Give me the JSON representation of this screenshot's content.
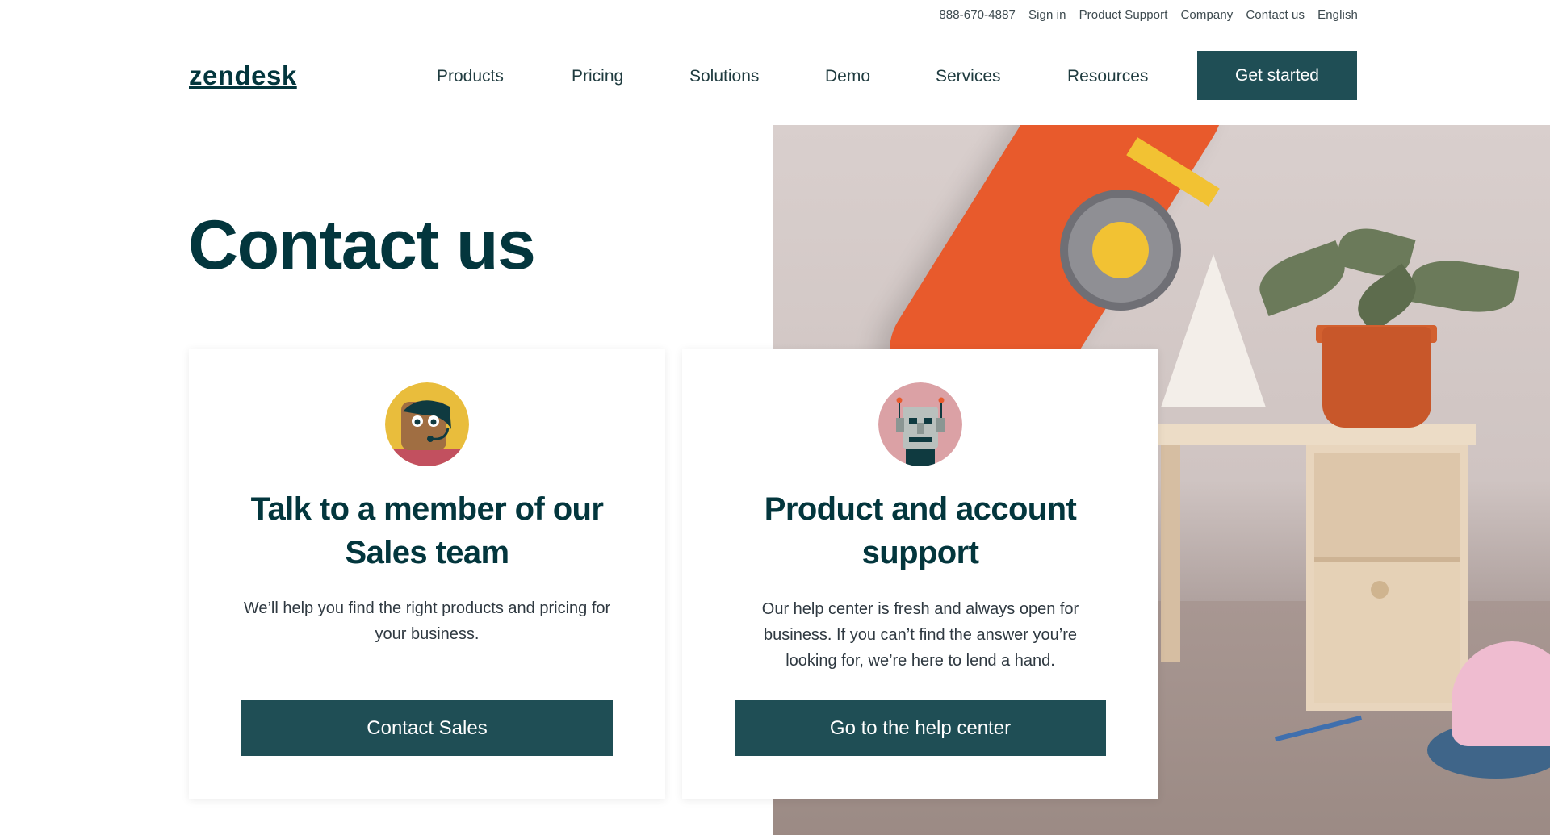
{
  "utility_nav": {
    "phone": "888-670-4887",
    "sign_in": "Sign in",
    "product_support": "Product Support",
    "company": "Company",
    "contact_us": "Contact us",
    "language": "English"
  },
  "header": {
    "logo": "zendesk",
    "nav": [
      "Products",
      "Pricing",
      "Solutions",
      "Demo",
      "Services",
      "Resources"
    ],
    "cta": "Get started"
  },
  "page_title": "Contact us",
  "cards": [
    {
      "heading": "Talk to a member of our Sales team",
      "body": "We’ll help you find the right products and pricing for your business.",
      "button": "Contact Sales",
      "avatar_icon": "sales-agent-avatar-icon",
      "avatar_color": "#e9bd3c"
    },
    {
      "heading": "Product and account support",
      "body": "Our help center is fresh and always open for business. If you can’t find the answer you’re looking for, we’re here to lend a hand.",
      "button": "Go to the help center",
      "avatar_icon": "robot-avatar-icon",
      "avatar_color": "#dba1a5"
    }
  ],
  "colors": {
    "brand_dark": "#03363d",
    "button_bg": "#1f4e55"
  }
}
